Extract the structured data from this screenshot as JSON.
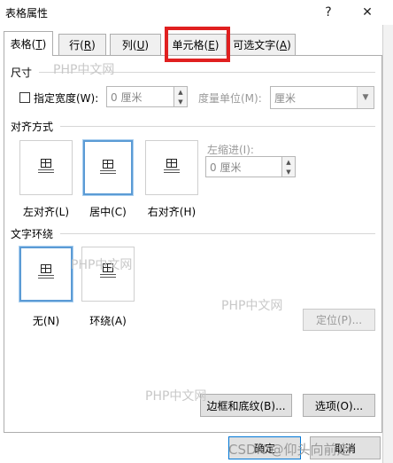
{
  "window": {
    "title": "表格属性",
    "help": "?",
    "close": "✕"
  },
  "tabs": [
    {
      "label": "表格(",
      "key": "T",
      "suffix": ")"
    },
    {
      "label": "行(",
      "key": "R",
      "suffix": ")"
    },
    {
      "label": "列(",
      "key": "U",
      "suffix": ")"
    },
    {
      "label": "单元格(",
      "key": "E",
      "suffix": ")"
    },
    {
      "label": "可选文字(",
      "key": "A",
      "suffix": ")"
    }
  ],
  "size": {
    "heading": "尺寸",
    "specify_width_label": "指定宽度(W):",
    "width_value": "0 厘米",
    "unit_label": "度量单位(M):",
    "unit_value": "厘米"
  },
  "alignment": {
    "heading": "对齐方式",
    "options": [
      "左对齐(L)",
      "居中(C)",
      "右对齐(H)"
    ],
    "indent_label": "左缩进(I):",
    "indent_value": "0 厘米"
  },
  "wrapping": {
    "heading": "文字环绕",
    "options": [
      "无(N)",
      "环绕(A)"
    ],
    "position_button": "定位(P)..."
  },
  "buttons": {
    "borders": "边框和底纹(B)...",
    "options": "选项(O)...",
    "ok": "确定",
    "cancel": "取消"
  },
  "watermarks": [
    "PHP中文网",
    "PHP中文网",
    "PHP中文网",
    "PHP中文网",
    "CSDN @仰头向前走"
  ]
}
